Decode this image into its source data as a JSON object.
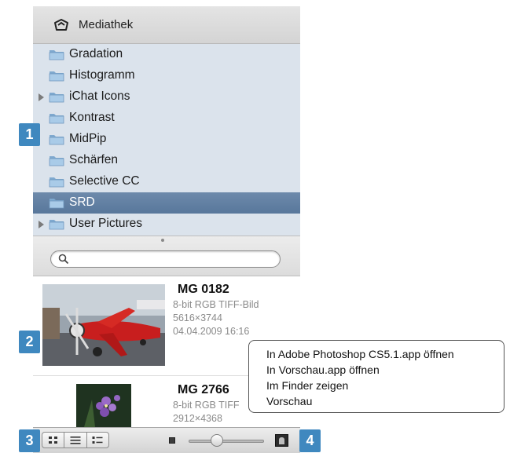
{
  "library": {
    "title": "Mediathek",
    "icon": "media-library-icon"
  },
  "folders": [
    {
      "label": "Gradation",
      "expandable": false,
      "selected": false
    },
    {
      "label": "Histogramm",
      "expandable": false,
      "selected": false
    },
    {
      "label": "iChat Icons",
      "expandable": true,
      "selected": false
    },
    {
      "label": "Kontrast",
      "expandable": false,
      "selected": false
    },
    {
      "label": "MidPip",
      "expandable": false,
      "selected": false
    },
    {
      "label": "Schärfen",
      "expandable": false,
      "selected": false
    },
    {
      "label": "Selective CC",
      "expandable": false,
      "selected": false
    },
    {
      "label": "SRD",
      "expandable": false,
      "selected": true
    },
    {
      "label": "User Pictures",
      "expandable": true,
      "selected": false
    }
  ],
  "search": {
    "placeholder": "",
    "value": "",
    "icon": "search-icon"
  },
  "results": [
    {
      "title": "MG 0182",
      "type": "8-bit RGB TIFF-Bild",
      "size": "5616×3744",
      "date": "04.04.2009 16:16",
      "thumbnail": "red-aerobatic-plane"
    },
    {
      "title": "MG 2766",
      "type": "8-bit RGB TIFF",
      "size": "2912×4368",
      "thumbnail": "purple-flowers"
    }
  ],
  "context_menu": {
    "items": [
      "In Adobe Photoshop CS5.1.app öffnen",
      "In Vorschau.app öffnen",
      "Im Finder zeigen",
      "Vorschau"
    ]
  },
  "view_modes": [
    "grid-view-icon",
    "list-view-icon",
    "detail-view-icon"
  ],
  "thumbnail_size_slider": {
    "value": 0.35
  },
  "callouts": [
    "1",
    "2",
    "3",
    "4"
  ],
  "colors": {
    "callout": "#3f88bf",
    "selection": "#5f7fa3",
    "sidebar_bg": "#dbe3ec"
  }
}
